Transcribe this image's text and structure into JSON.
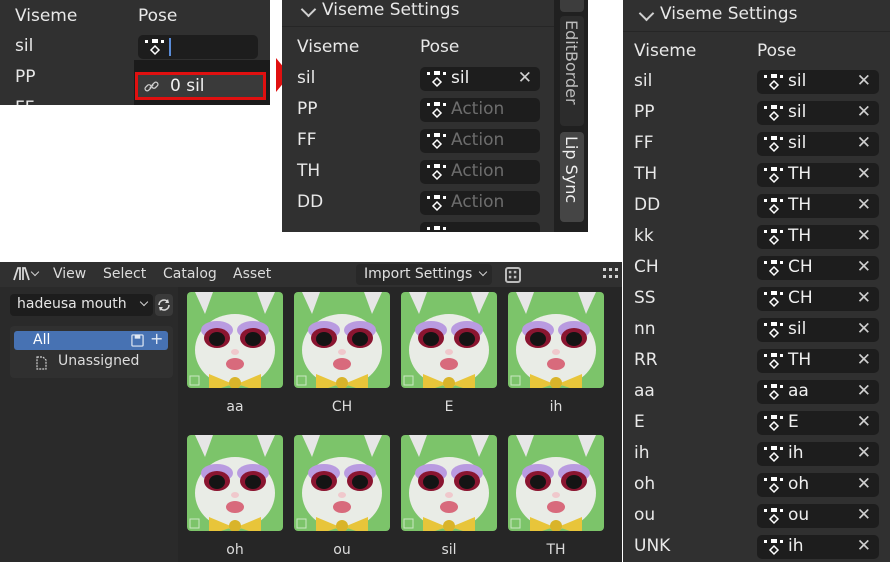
{
  "panelA": {
    "header_viseme": "Viseme",
    "header_pose": "Pose",
    "rows": [
      "sil",
      "PP",
      "FF"
    ],
    "dropdown_item": "0 sil"
  },
  "panelB": {
    "title": "Viseme Settings",
    "header_viseme": "Viseme",
    "header_pose": "Pose",
    "placeholder": "Action",
    "rows": [
      {
        "viseme": "sil",
        "pose": "sil"
      },
      {
        "viseme": "PP",
        "pose": ""
      },
      {
        "viseme": "FF",
        "pose": ""
      },
      {
        "viseme": "TH",
        "pose": ""
      },
      {
        "viseme": "DD",
        "pose": ""
      }
    ],
    "side_tabs": [
      "EditBorder",
      "Lip Sync"
    ]
  },
  "panelC": {
    "title": "Viseme Settings",
    "header_viseme": "Viseme",
    "header_pose": "Pose",
    "rows": [
      {
        "viseme": "sil",
        "pose": "sil"
      },
      {
        "viseme": "PP",
        "pose": "sil"
      },
      {
        "viseme": "FF",
        "pose": "sil"
      },
      {
        "viseme": "TH",
        "pose": "TH"
      },
      {
        "viseme": "DD",
        "pose": "TH"
      },
      {
        "viseme": "kk",
        "pose": "TH"
      },
      {
        "viseme": "CH",
        "pose": "CH"
      },
      {
        "viseme": "SS",
        "pose": "CH"
      },
      {
        "viseme": "nn",
        "pose": "sil"
      },
      {
        "viseme": "RR",
        "pose": "TH"
      },
      {
        "viseme": "aa",
        "pose": "aa"
      },
      {
        "viseme": "E",
        "pose": "E"
      },
      {
        "viseme": "ih",
        "pose": "ih"
      },
      {
        "viseme": "oh",
        "pose": "oh"
      },
      {
        "viseme": "ou",
        "pose": "ou"
      },
      {
        "viseme": "UNK",
        "pose": "ih"
      }
    ]
  },
  "assetBrowser": {
    "menu": [
      "View",
      "Select",
      "Catalog",
      "Asset"
    ],
    "import_settings": "Import Settings",
    "library": "hadeusa mouth",
    "catalog_all": "All",
    "catalog_unassigned": "Unassigned",
    "assets": [
      "aa",
      "CH",
      "E",
      "ih",
      "oh",
      "ou",
      "sil",
      "TH"
    ]
  },
  "colors": {
    "panel_bg": "#303030",
    "field_bg": "#1d1d1d",
    "highlight_red": "#e01010",
    "selected_blue": "#4772b3",
    "thumb_green": "#7cc46a"
  }
}
